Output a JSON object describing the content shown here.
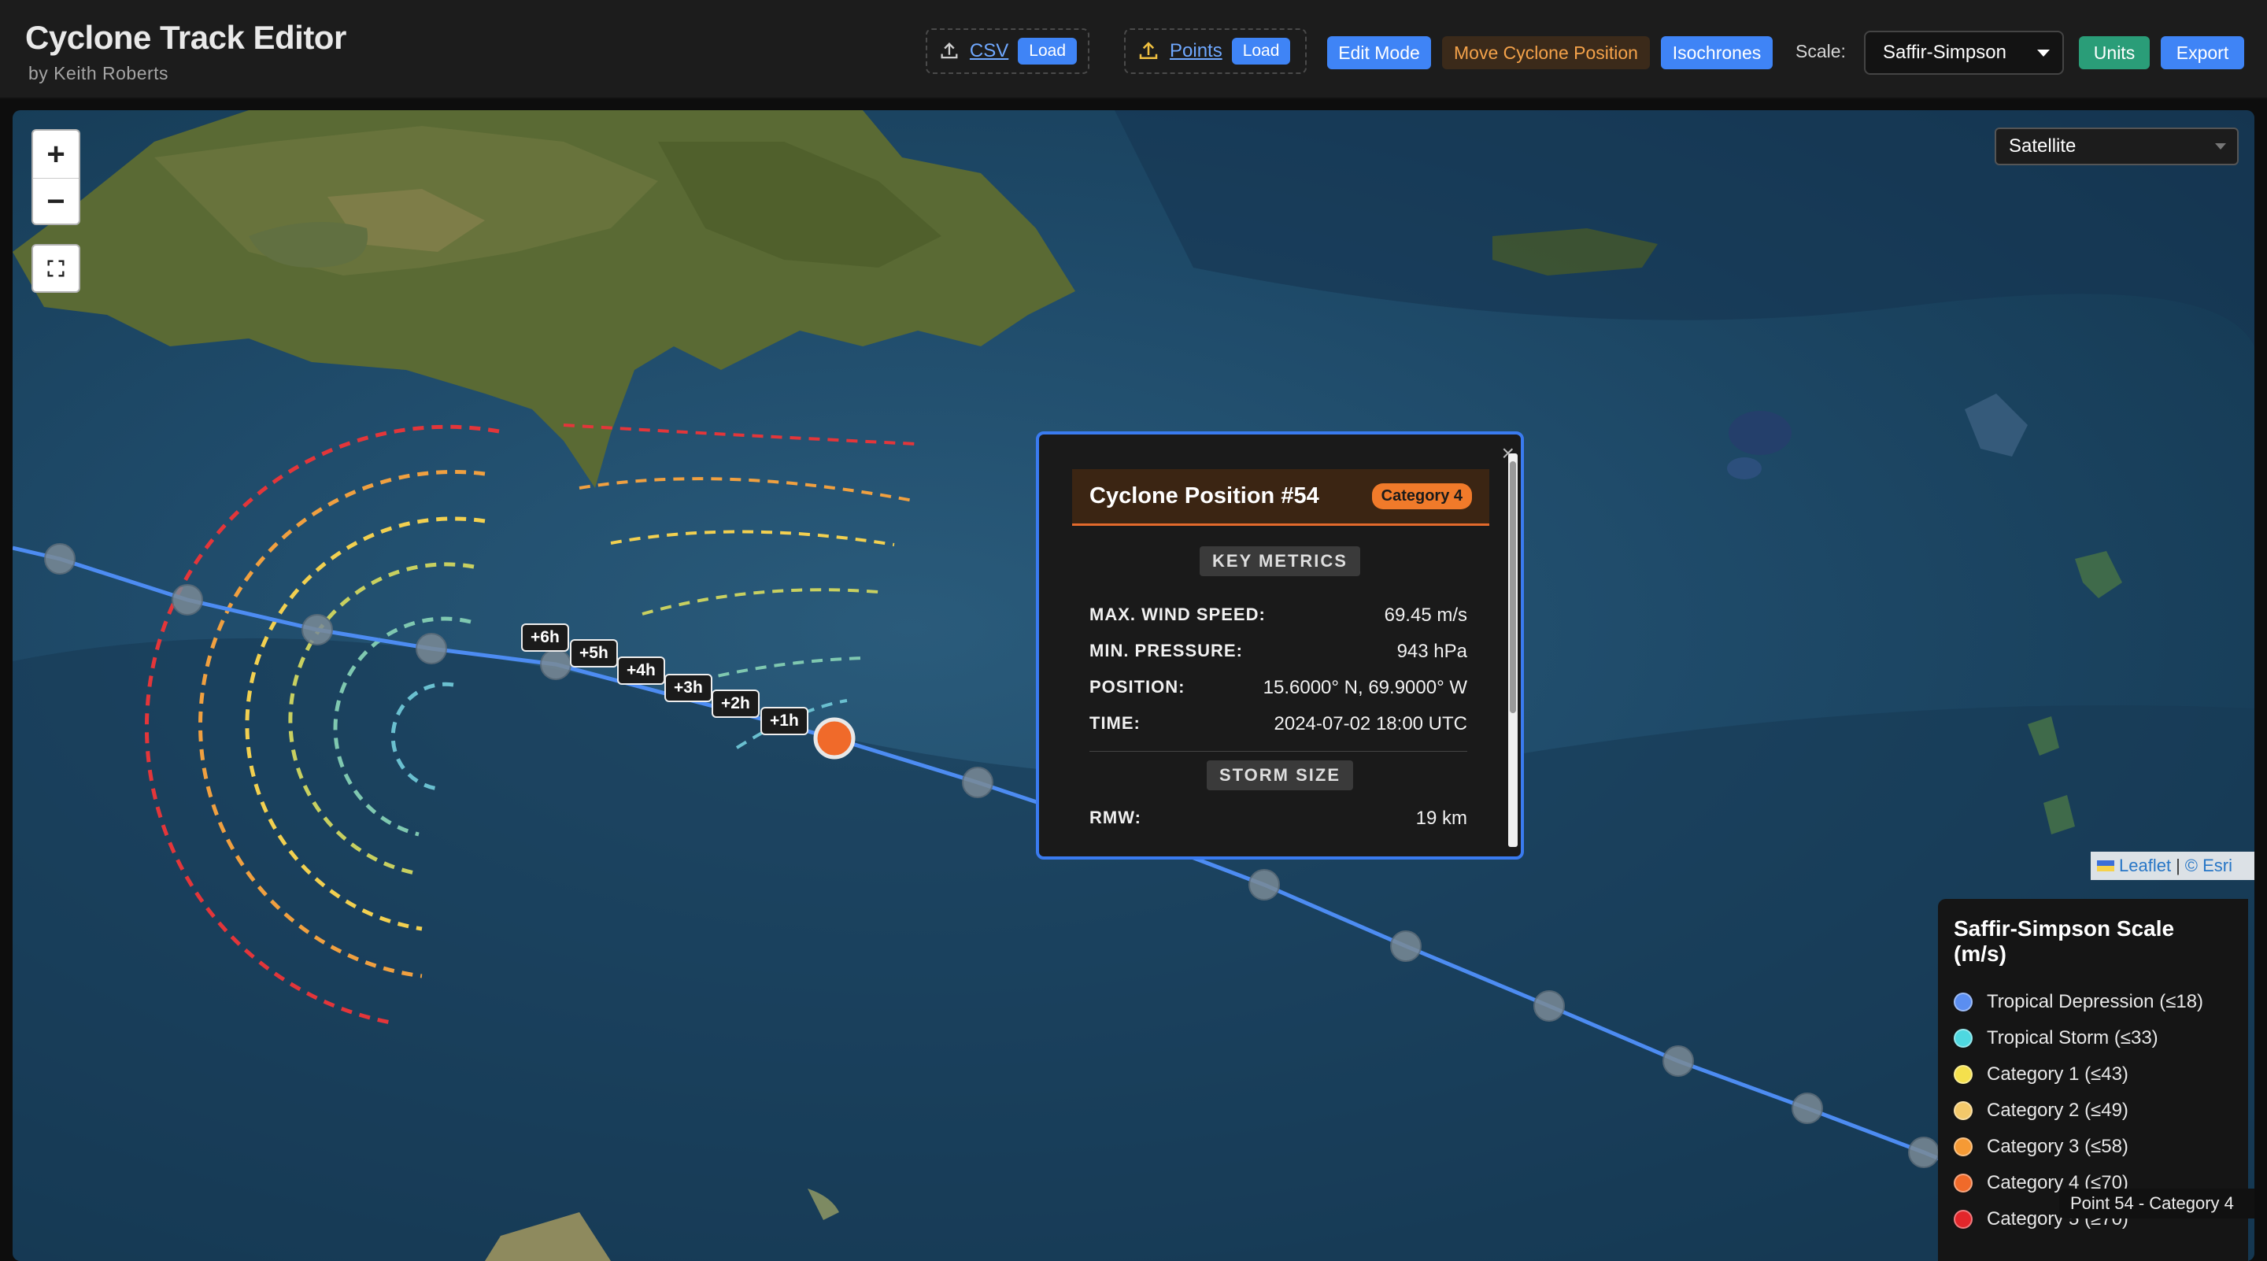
{
  "app": {
    "title": "Cyclone Track Editor",
    "subtitle": "by Keith Roberts"
  },
  "toolbar": {
    "csv_link": "CSV",
    "csv_load": "Load",
    "points_link": "Points",
    "points_load": "Load",
    "edit_mode": "Edit Mode",
    "move_position": "Move Cyclone Position",
    "isochrones": "Isochrones",
    "scale_label": "Scale:",
    "scale_value": "Saffir-Simpson",
    "units": "Units",
    "export": "Export"
  },
  "map": {
    "layer": "Satellite",
    "zoom_in": "+",
    "zoom_out": "−",
    "isochrone_labels": [
      "+6h",
      "+5h",
      "+4h",
      "+3h",
      "+2h",
      "+1h"
    ],
    "attribution_leaflet": "Leaflet",
    "attribution_sep": "|",
    "attribution_esri": "© Esri",
    "hover_tip": "Point 54 - Category 4"
  },
  "popup": {
    "title": "Cyclone Position #54",
    "category": "Category 4",
    "section_metrics": "KEY METRICS",
    "metrics": [
      {
        "key": "MAX. WIND SPEED:",
        "value": "69.45 m/s"
      },
      {
        "key": "MIN. PRESSURE:",
        "value": "943 hPa"
      },
      {
        "key": "POSITION:",
        "value": "15.6000° N, 69.9000° W"
      },
      {
        "key": "TIME:",
        "value": "2024-07-02 18:00 UTC"
      }
    ],
    "section_size": "STORM SIZE",
    "size": [
      {
        "key": "RMW:",
        "value": "19 km"
      }
    ],
    "close": "×"
  },
  "legend": {
    "title": "Saffir-Simpson Scale (m/s)",
    "items": [
      {
        "label": "Tropical Depression (≤18)",
        "color": "#5b8ef0"
      },
      {
        "label": "Tropical Storm (≤33)",
        "color": "#4fd8e0"
      },
      {
        "label": "Category 1 (≤43)",
        "color": "#f4e04d"
      },
      {
        "label": "Category 2 (≤49)",
        "color": "#f3c86a"
      },
      {
        "label": "Category 3 (≤58)",
        "color": "#f59a35"
      },
      {
        "label": "Category 4 (≤70)",
        "color": "#f06a2a"
      },
      {
        "label": "Category 5 (≥70)",
        "color": "#e3262b"
      }
    ]
  },
  "colors": {
    "track": "#4d8cf2",
    "current_point": "#f06a2a",
    "popup_border": "#3a7bf0"
  },
  "icons": [
    "upload-icon",
    "fullscreen-icon",
    "chevron-down-icon",
    "close-icon"
  ]
}
